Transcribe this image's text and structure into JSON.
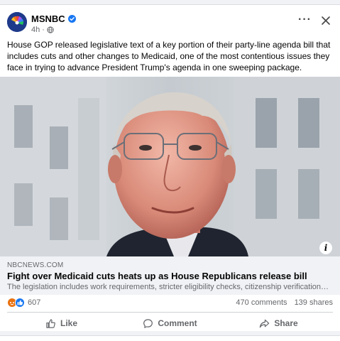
{
  "post": {
    "page_name": "MSNBC",
    "time_ago": "4h",
    "separator": "·",
    "text": "House GOP released legislative text of a key portion of their party-line agenda bill that includes cuts and other changes to Medicaid, one of the most contentious issues they face in trying to advance President Trump's agenda in one sweeping package.",
    "more_icon": "more-horizontal-icon",
    "close_icon": "close-icon"
  },
  "link_preview": {
    "source": "NBCNEWS.COM",
    "title": "Fight over Medicaid cuts heats up as House Republicans release bill",
    "description": "The legislation includes work requirements, stricter eligibility checks, citizenship verification and more.",
    "info_label": "i"
  },
  "stats": {
    "reaction_count": "607",
    "comments": "470 comments",
    "shares": "139 shares"
  },
  "actions": {
    "like": "Like",
    "comment": "Comment",
    "share": "Share"
  },
  "colors": {
    "brand_blue": "#1877f2",
    "angry_orange": "#e9710f",
    "secondary_text": "#65676b"
  }
}
